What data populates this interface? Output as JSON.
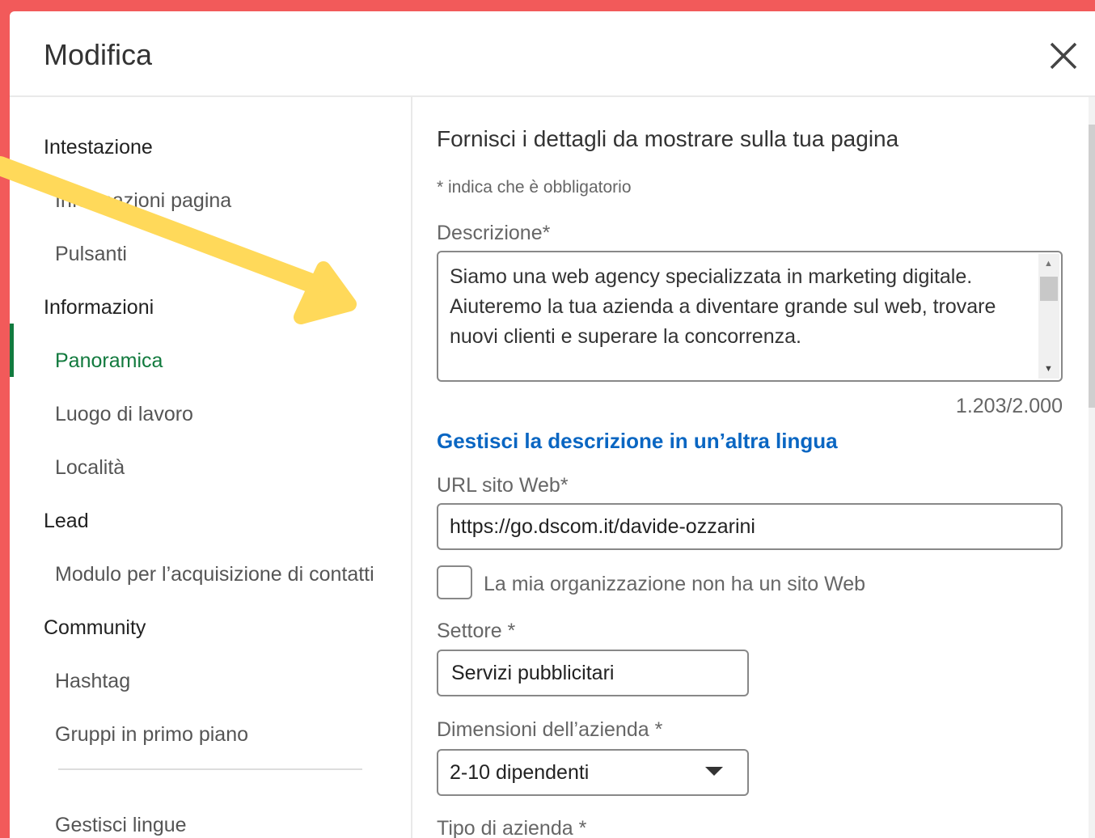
{
  "modal": {
    "title": "Modifica"
  },
  "sidebar": {
    "sections": [
      {
        "heading": "Intestazione",
        "items": [
          "Informazioni pagina",
          "Pulsanti"
        ]
      },
      {
        "heading": "Informazioni",
        "items": [
          "Panoramica",
          "Luogo di lavoro",
          "Località"
        ]
      },
      {
        "heading": "Lead",
        "items": [
          "Modulo per l’acquisizione di contatti"
        ]
      },
      {
        "heading": "Community",
        "items": [
          "Hashtag",
          "Gruppi in primo piano"
        ]
      }
    ],
    "footer_item": "Gestisci lingue",
    "active_item": "Panoramica"
  },
  "form": {
    "intro": "Fornisci i dettagli da mostrare sulla tua pagina",
    "required_note": "* indica che è obbligatorio",
    "description": {
      "label": "Descrizione*",
      "value": "Siamo una web agency specializzata in marketing digitale. Aiuteremo la tua azienda a diventare grande sul web, trovare nuovi clienti e superare la concorrenza.",
      "counter": "1.203/2.000"
    },
    "language_link": "Gestisci la descrizione in un’altra lingua",
    "website": {
      "label": "URL sito Web*",
      "value": "https://go.dscom.it/davide-ozzarini"
    },
    "no_website_checkbox": {
      "label": "La mia organizzazione non ha un sito Web",
      "checked": false
    },
    "industry": {
      "label": "Settore *",
      "value": "Servizi pubblicitari"
    },
    "company_size": {
      "label": "Dimensioni dell’azienda *",
      "value": "2-10 dipendenti"
    },
    "company_type": {
      "label": "Tipo di azienda *"
    }
  },
  "colors": {
    "background": "#f25a5a",
    "accent_green": "#127a3e",
    "link_blue": "#0a66c2",
    "annotation_arrow": "#ffd95a"
  },
  "icons": {
    "close": "close-icon",
    "dropdown": "chevron-down-icon",
    "annotation": "arrow-annotation"
  }
}
